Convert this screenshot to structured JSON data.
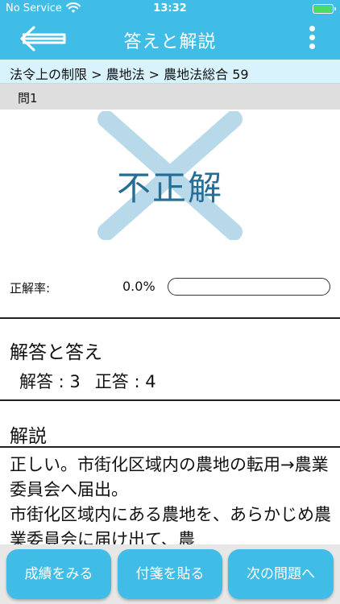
{
  "status_bar": {
    "carrier": "No Service",
    "time": "13:32",
    "icons": [
      "wifi-icon",
      "battery-icon"
    ]
  },
  "nav": {
    "title": "答えと解説",
    "back_icon": "arrow-left-icon",
    "menu_icon": "more-vertical-icon"
  },
  "breadcrumb": "法令上の制限 > 農地法 > 農地法総合 59",
  "question_label": "問1",
  "result": {
    "verdict": "不正解",
    "mark_icon": "cross-mark-icon"
  },
  "rate": {
    "label": "正解率:",
    "value_text": "0.0%",
    "value": 0.0
  },
  "answer_section": {
    "title": "解答と答え",
    "your_answer_label": "解答 : 3",
    "correct_answer_label": "正答 : 4"
  },
  "explanation": {
    "title": "解説",
    "text": "正しい。市街化区域内の農地の転用→農業委員会へ届出。\n市街化区域内にある農地を、あらかじめ農業委員会に届け出て、農"
  },
  "colors": {
    "accent": "#3fbde6",
    "verdict": "#276e96",
    "cross": "#b8d9ea"
  },
  "buttons": {
    "results": "成績をみる",
    "sticky": "付箋を貼る",
    "next": "次の問題へ"
  }
}
